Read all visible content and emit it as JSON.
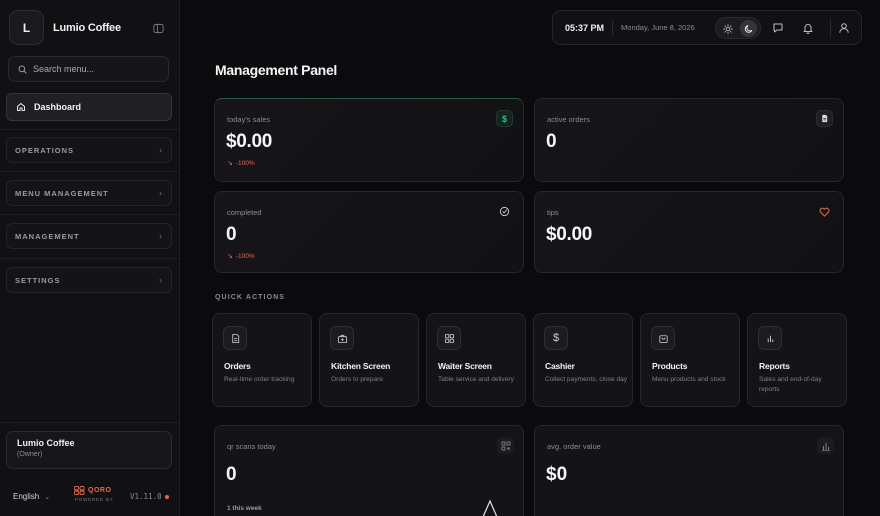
{
  "brand": {
    "initial": "L",
    "name": "Lumio Coffee"
  },
  "search": {
    "placeholder": "Search menu..."
  },
  "nav": {
    "dashboard": "Dashboard",
    "groups": [
      "OPERATIONS",
      "MENU MANAGEMENT",
      "MANAGEMENT",
      "SETTINGS"
    ]
  },
  "user": {
    "name": "Lumio Coffee",
    "role": "(Owner)"
  },
  "footer": {
    "language": "English",
    "powered_brand": "QORO",
    "powered_by": "POWERED BY",
    "version": "V1.11.0"
  },
  "topbar": {
    "time": "05:37 PM",
    "date": "Monday, June 8, 2026"
  },
  "page": {
    "title": "Management Panel"
  },
  "stats": [
    {
      "label": "today's sales",
      "value": "$0.00",
      "delta": "-100%",
      "icon": "dollar-icon"
    },
    {
      "label": "active orders",
      "value": "0",
      "delta": "",
      "icon": "document-icon"
    },
    {
      "label": "completed",
      "value": "0",
      "delta": "-100%",
      "icon": "check-circle-icon"
    },
    {
      "label": "tips",
      "value": "$0.00",
      "delta": "",
      "icon": "heart-icon"
    }
  ],
  "quick_actions": {
    "title": "QUICK ACTIONS",
    "items": [
      {
        "title": "Orders",
        "desc": "Real-time order tracking",
        "icon": "document-icon"
      },
      {
        "title": "Kitchen Screen",
        "desc": "Orders to prepare",
        "icon": "kitchen-icon"
      },
      {
        "title": "Waiter Screen",
        "desc": "Table service and delivery",
        "icon": "grid-icon"
      },
      {
        "title": "Cashier",
        "desc": "Collect payments, close day",
        "icon": "dollar-icon"
      },
      {
        "title": "Products",
        "desc": "Menu products and stock",
        "icon": "bag-icon"
      },
      {
        "title": "Reports",
        "desc": "Sales and end-of-day reports",
        "icon": "bar-chart-icon"
      }
    ]
  },
  "bottom": [
    {
      "label": "qr scans today",
      "value": "0",
      "sub": "1 this week",
      "icon": "qr-icon"
    },
    {
      "label": "avg. order value",
      "value": "$0",
      "icon": "bar-chart-icon"
    }
  ],
  "colors": {
    "accent": "#e8694a",
    "success": "#3fb88a",
    "background": "#0b0b0d"
  }
}
